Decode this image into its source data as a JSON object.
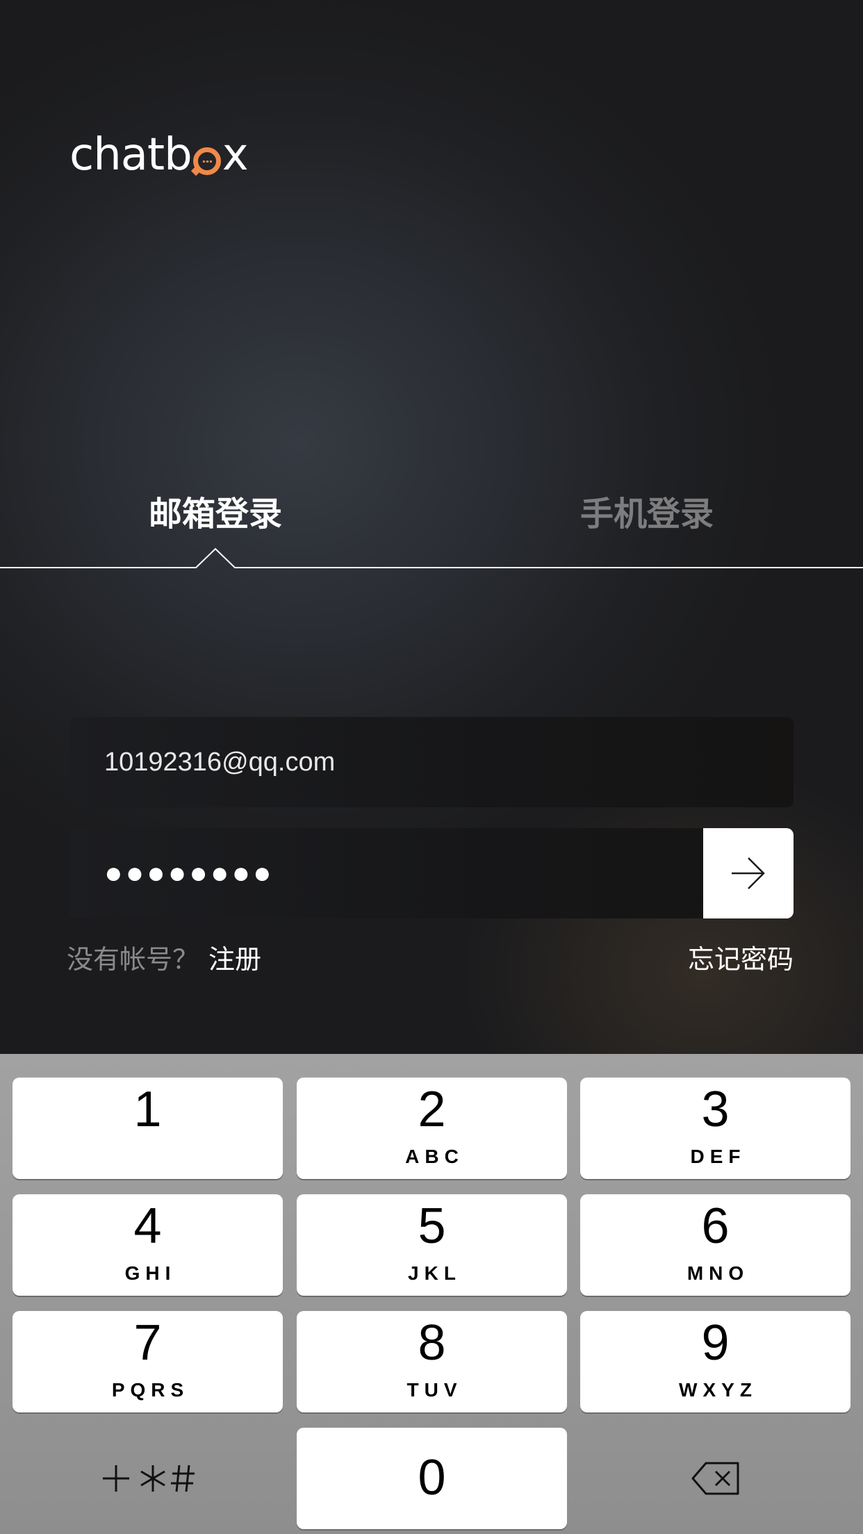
{
  "app": {
    "logo_text_1": "chatb",
    "logo_text_2": "x"
  },
  "tabs": [
    {
      "label": "邮箱登录",
      "active": true
    },
    {
      "label": "手机登录",
      "active": false
    }
  ],
  "form": {
    "email_value": "10192316@qq.com",
    "password_mask": "●●●●●●●●",
    "submit_icon": "arrow-right-icon"
  },
  "links": {
    "no_account": "没有帐号？",
    "register": "注册",
    "forgot": "忘记密码"
  },
  "keypad": {
    "keys": [
      {
        "num": "1",
        "letters": ""
      },
      {
        "num": "2",
        "letters": "ABC"
      },
      {
        "num": "3",
        "letters": "DEF"
      },
      {
        "num": "4",
        "letters": "GHI"
      },
      {
        "num": "5",
        "letters": "JKL"
      },
      {
        "num": "6",
        "letters": "MNO"
      },
      {
        "num": "7",
        "letters": "PQRS"
      },
      {
        "num": "8",
        "letters": "TUV"
      },
      {
        "num": "9",
        "letters": "WXYZ"
      },
      {
        "num": "0",
        "letters": ""
      }
    ],
    "symbols_label": "+*#",
    "delete_icon": "backspace-icon"
  },
  "colors": {
    "accent": "#f0894a",
    "active_tab": "#ffffff",
    "inactive_tab": "#7d7d7f"
  }
}
